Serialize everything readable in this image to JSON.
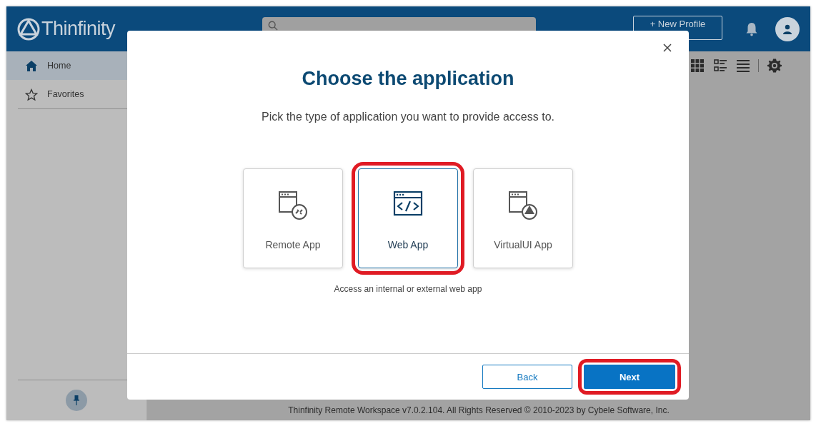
{
  "header": {
    "logo": "Thinfinity",
    "new_profile_button": "+ New Profile"
  },
  "sidebar": {
    "items": [
      {
        "label": "Home",
        "kind": "home",
        "selected": true
      },
      {
        "label": "Favorites",
        "kind": "star",
        "selected": false
      }
    ]
  },
  "toolbar": {
    "views": [
      {
        "kind": "grid",
        "selected": false
      },
      {
        "kind": "detail",
        "selected": false
      },
      {
        "kind": "list",
        "selected": false
      }
    ]
  },
  "footer": "Thinfinity Remote Workspace v7.0.2.104. All Rights Reserved © 2010-2023 by Cybele Software, Inc.",
  "dialog": {
    "title": "Choose the application",
    "subtitle": "Pick the type of application you want to provide access to.",
    "options": [
      {
        "label": "Remote App",
        "kind": "remote",
        "selected": false,
        "highlighted": false
      },
      {
        "label": "Web App",
        "kind": "web",
        "selected": true,
        "highlighted": true
      },
      {
        "label": "VirtualUI App",
        "kind": "virtualui",
        "selected": false,
        "highlighted": false
      }
    ],
    "description": "Access an internal or external web app",
    "buttons": [
      {
        "label": "Back",
        "kind": "secondary",
        "highlighted": false
      },
      {
        "label": "Next",
        "kind": "primary",
        "highlighted": true
      }
    ]
  }
}
